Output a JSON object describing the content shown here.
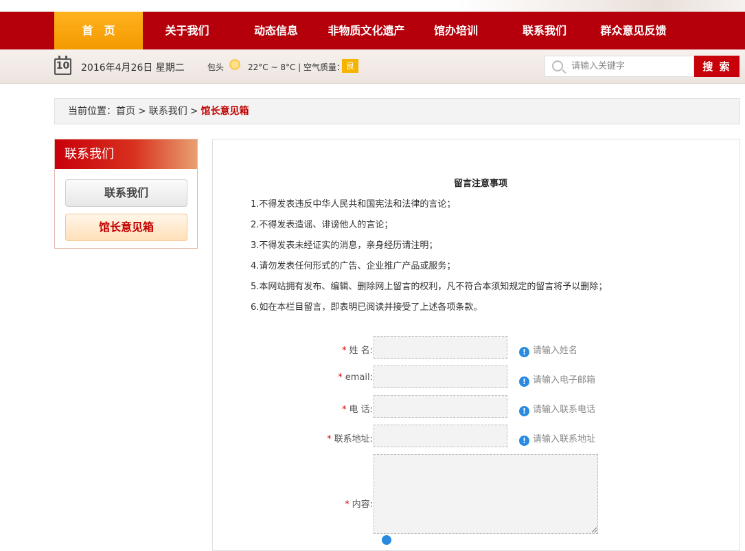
{
  "nav": {
    "items": [
      "首　页",
      "关于我们",
      "动态信息",
      "非物质文化遗产",
      "馆办培训",
      "联系我们",
      "群众意见反馈"
    ]
  },
  "infobar": {
    "calendar_day": "10",
    "date": "2016年4月26日 星期二",
    "city": "包头",
    "weather": "22°C ~ 8°C | 空气质量：",
    "air_quality": "良",
    "search_placeholder": "请输入关键字",
    "search_label": "搜 索"
  },
  "breadcrumb": {
    "prefix": "当前位置：",
    "home": "首页",
    "sep": ">",
    "level2": "联系我们",
    "current": "馆长意见箱"
  },
  "sidebar": {
    "title": "联系我们",
    "items": [
      "联系我们",
      "馆长意见箱"
    ]
  },
  "notice": {
    "title": "留言注意事项",
    "lines": [
      "1.不得发表违反中华人民共和国宪法和法律的言论；",
      "2.不得发表造谣、诽谤他人的言论；",
      "3.不得发表未经证实的消息，亲身经历请注明；",
      "4.请勿发表任何形式的广告、企业推广产品或服务；",
      "5.本网站拥有发布、编辑、删除网上留言的权利，凡不符合本须知规定的留言将予以删除；",
      "6.如在本栏目留言，即表明已阅读并接受了上述各项条款。"
    ]
  },
  "form": {
    "star": "*",
    "hint_icon": "!",
    "fields": [
      {
        "label": "姓 名:",
        "hint": "请输入姓名",
        "value": ""
      },
      {
        "label": "email:",
        "hint": "请输入电子邮箱",
        "value": ""
      },
      {
        "label": "电 话:",
        "hint": "请输入联系电话",
        "value": ""
      },
      {
        "label": "联系地址:",
        "hint": "请输入联系地址",
        "value": ""
      }
    ],
    "content_label": "内容:"
  }
}
